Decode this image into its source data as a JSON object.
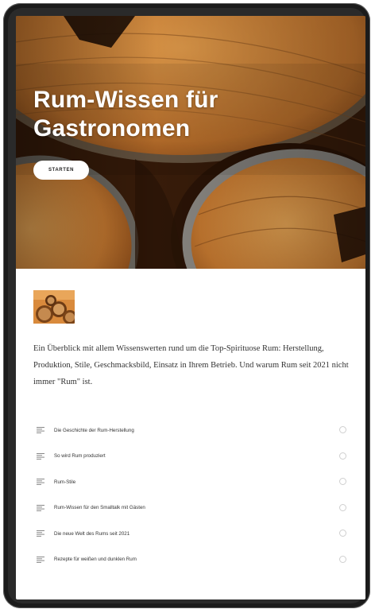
{
  "hero": {
    "title_line1": "Rum-Wissen für",
    "title_line2": "Gastronomen",
    "start_label": "STARTEN"
  },
  "course": {
    "description": "Ein Überblick mit allem Wissenswerten rund um die Top-Spirituose Rum: Herstellung, Produktion, Stile, Geschmacksbild, Einsatz in Ihrem Betrieb. Und warum Rum seit 2021 nicht immer \"Rum\" ist."
  },
  "lessons": [
    {
      "label": "Die Geschichte der Rum-Herstellung"
    },
    {
      "label": "So wird Rum produziert"
    },
    {
      "label": "Rum-Stile"
    },
    {
      "label": "Rum-Wissen für den Smalltalk mit Gästen"
    },
    {
      "label": "Die neue Welt des Rums seit 2021"
    },
    {
      "label": "Rezepte für weißen und dunklen Rum"
    }
  ],
  "colors": {
    "device_frame": "#1b1b1b",
    "barrel_wood": "#c47a32",
    "barrel_hoop": "#8a8a86",
    "text": "#333333"
  },
  "icons": {
    "lesson": "text-lines-icon",
    "status": "circle-outline-icon"
  }
}
